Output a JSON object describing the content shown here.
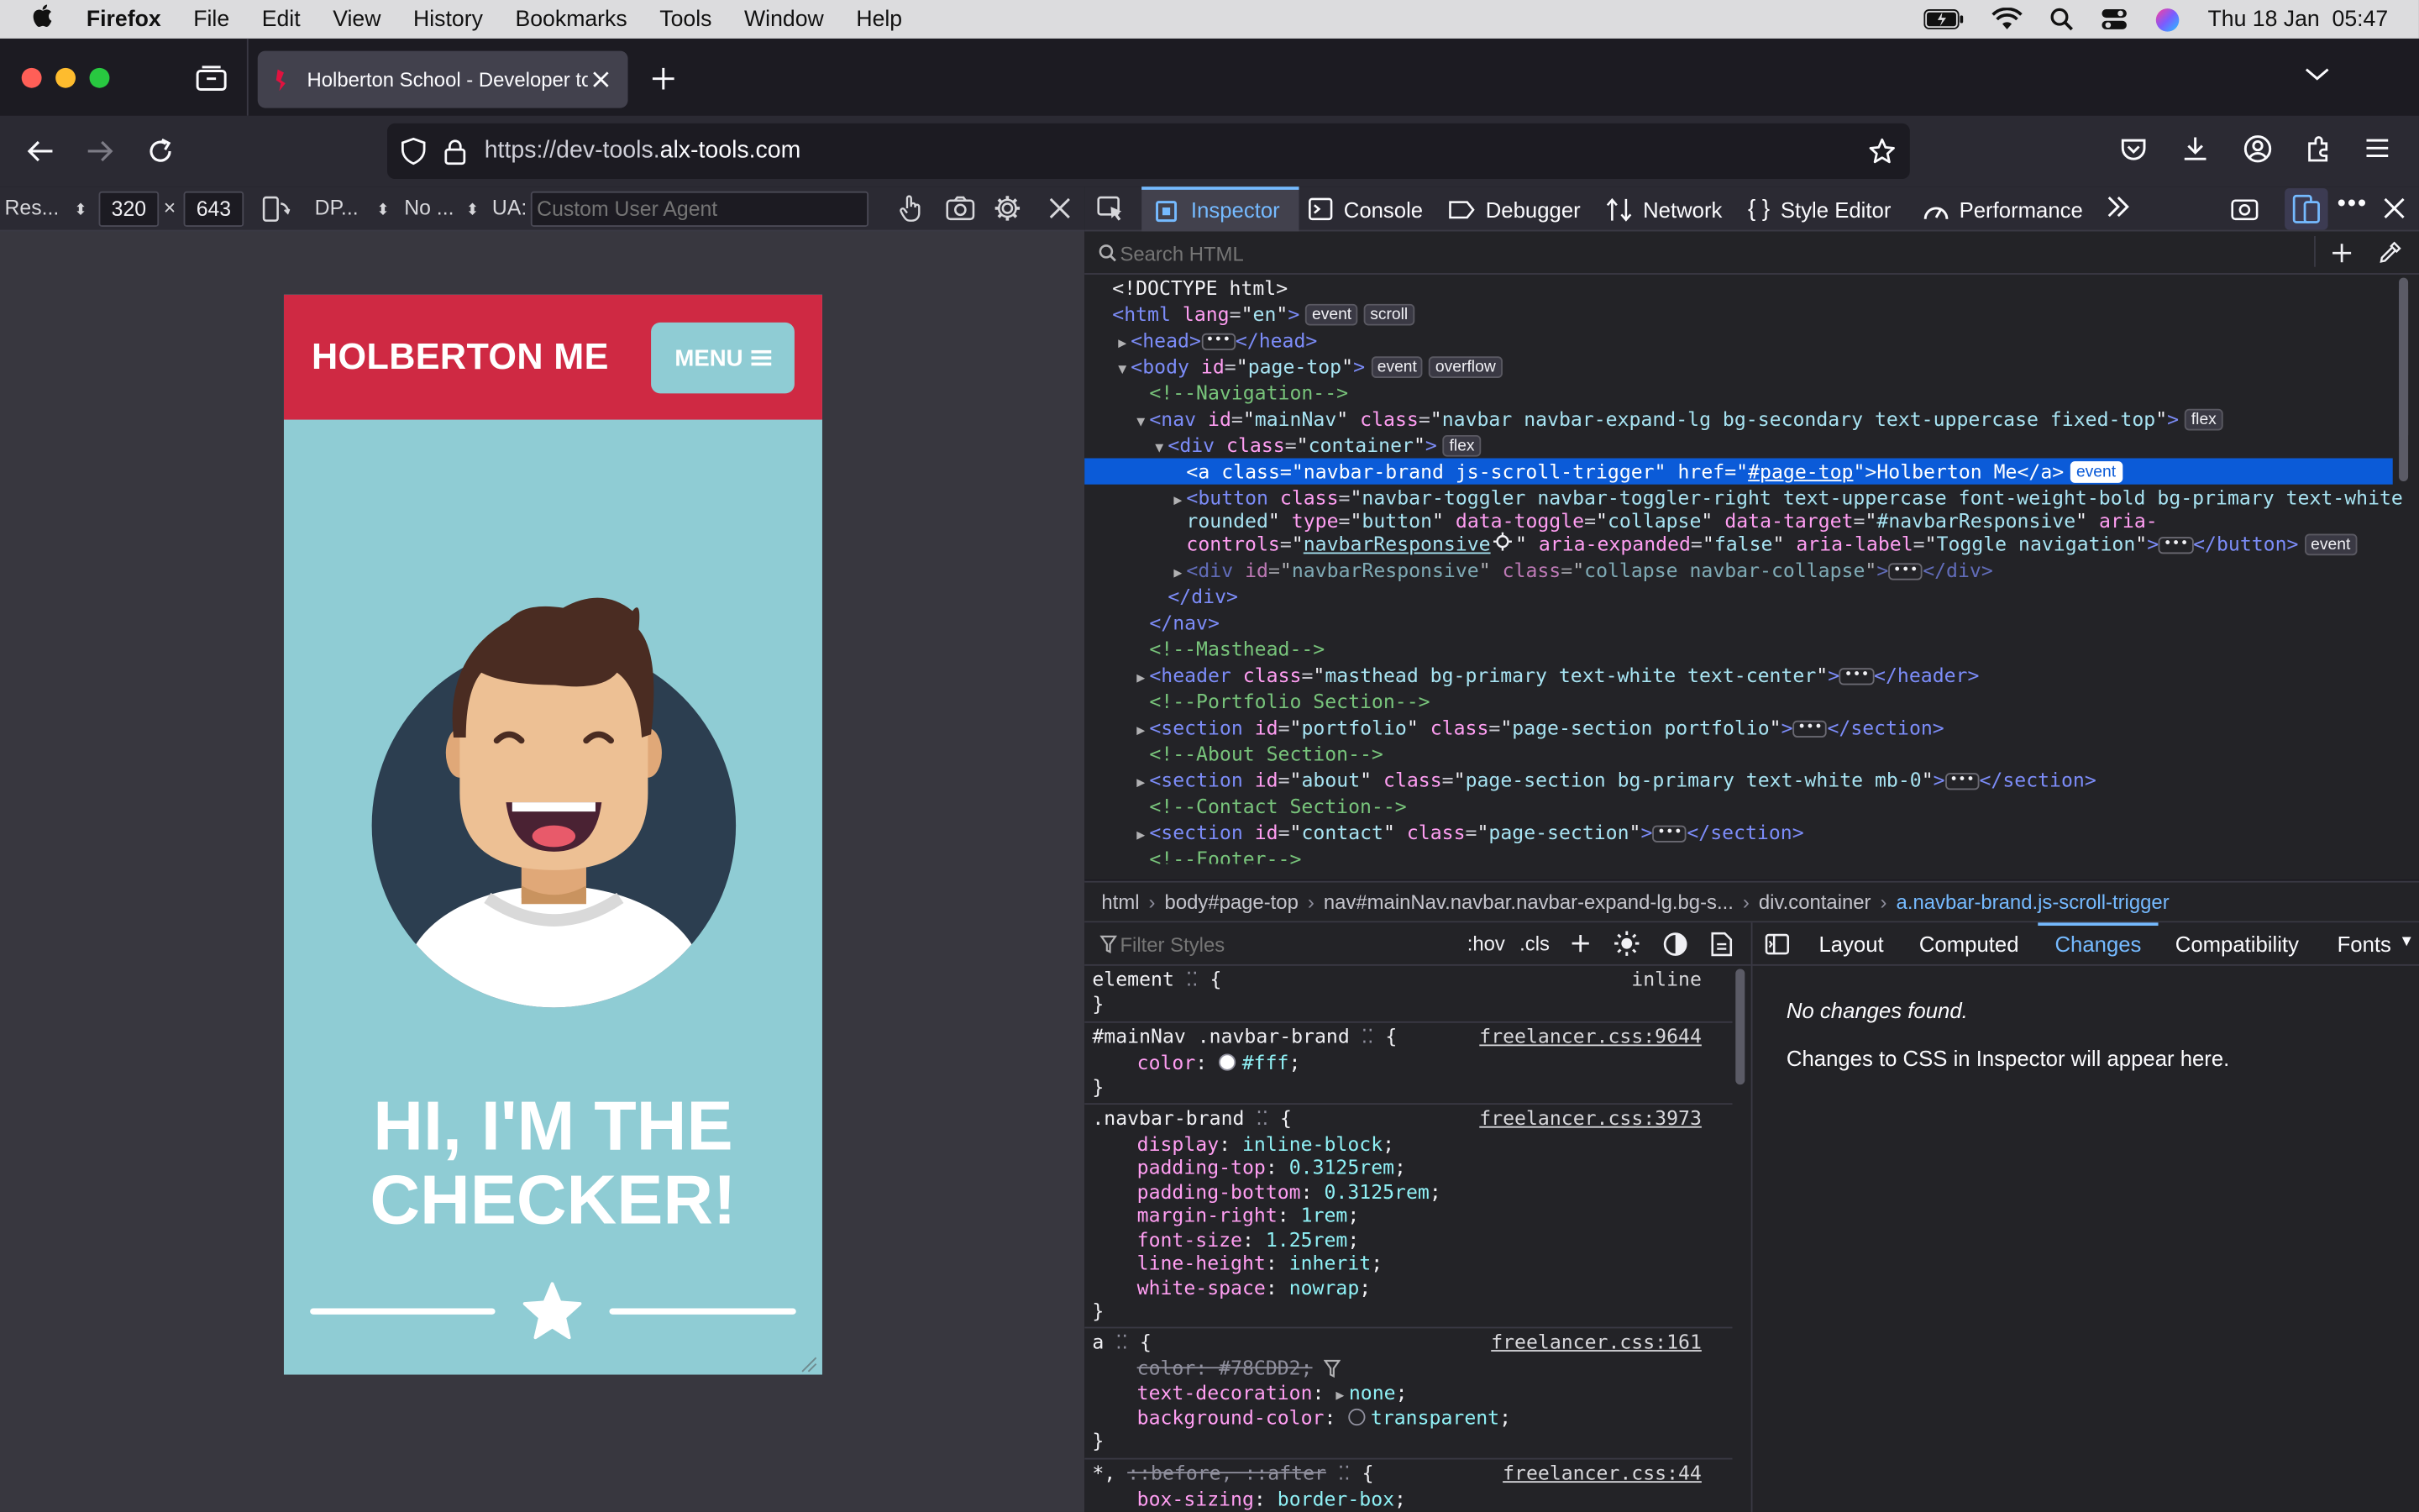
{
  "macos_menu": {
    "app_name": "Firefox",
    "items": [
      "File",
      "Edit",
      "View",
      "History",
      "Bookmarks",
      "Tools",
      "Window",
      "Help"
    ],
    "clock": "Thu 18 Jan  05:47"
  },
  "browser": {
    "tab_title": "Holberton School - Developer to",
    "url_prefix": "https://dev-tools.",
    "url_domain": "alx-tools.com"
  },
  "rdm": {
    "device_label": "Res...",
    "width": "320",
    "times": "×",
    "height": "643",
    "dpr_label": "DP...",
    "throttle_label": "No ...",
    "ua_label": "UA:",
    "ua_placeholder": "Custom User Agent"
  },
  "site": {
    "brand": "HOLBERTON ME",
    "menu_label": "MENU",
    "heading_line1": "HI, I'M THE",
    "heading_line2": "CHECKER!"
  },
  "devtools": {
    "tabs": [
      "Inspector",
      "Console",
      "Debugger",
      "Network",
      "Style Editor",
      "Performance"
    ],
    "search_placeholder": "Search HTML",
    "markup": {
      "doctype": "<!DOCTYPE html>",
      "html_tag": "html",
      "html_lang_attr": "lang",
      "html_lang_val": "en",
      "badge_event": "event",
      "badge_scroll": "scroll",
      "badge_overflow": "overflow",
      "badge_flex": "flex",
      "head_tag": "head",
      "body_tag": "body",
      "body_id_val": "page-top",
      "comment_navigation": "<!--Navigation-->",
      "nav_tag": "nav",
      "nav_id_val": "mainNav",
      "nav_class_val": "navbar navbar-expand-lg bg-secondary text-uppercase fixed-top",
      "div_tag": "div",
      "div_class_val": "container",
      "a_tag": "a",
      "a_class_val": "navbar-brand js-scroll-trigger",
      "a_href_val": "#page-top",
      "a_text": "Holberton Me",
      "button_tag": "button",
      "button_class_val": "navbar-toggler navbar-toggler-right text-uppercase font-weight-bold bg-primary text-white",
      "button_class_cont": "rounded",
      "button_type_val": "button",
      "button_toggle_val": "collapse",
      "button_target_val": "#navbarResponsive",
      "button_aria_controls_attr": "aria-",
      "button_aria_controls_attr2": "controls",
      "button_aria_controls_val": "navbarResponsive",
      "button_expanded_val": "false",
      "button_label_val": "Toggle navigation",
      "div2_id_val": "navbarResponsive",
      "div2_class_val": "collapse navbar-collapse",
      "comment_masthead": "<!--Masthead-->",
      "header_tag": "header",
      "header_class_val": "masthead bg-primary text-white text-center",
      "comment_portfolio": "<!--Portfolio Section-->",
      "section_tag": "section",
      "portfolio_id_val": "portfolio",
      "portfolio_class_val": "page-section portfolio",
      "comment_about": "<!--About Section-->",
      "about_id_val": "about",
      "about_class_val": "page-section bg-primary text-white mb-0",
      "comment_contact": "<!--Contact Section-->",
      "contact_id_val": "contact",
      "contact_class_val": "page-section",
      "comment_footer": "<!--Footer-->"
    },
    "breadcrumbs": [
      "html",
      "body#page-top",
      "nav#mainNav.navbar.navbar-expand-lg.bg-s...",
      "div.container",
      "a.navbar-brand.js-scroll-trigger"
    ],
    "filter_placeholder": "Filter Styles",
    "hov": ":hov",
    "cls": ".cls",
    "right_tabs": [
      "Layout",
      "Computed",
      "Changes",
      "Compatibility",
      "Fonts"
    ],
    "changes_title": "No changes found.",
    "changes_body": "Changes to CSS in Inspector will appear here.",
    "rules": {
      "element_selector": "element",
      "element_source": "inline",
      "r1_selector": "#mainNav .navbar-brand",
      "r1_source": "freelancer.css:9644",
      "r1_prop": "color",
      "r1_val": "#fff",
      "r2_selector": ".navbar-brand",
      "r2_source": "freelancer.css:3973",
      "r2_decls": [
        {
          "p": "display",
          "v": "inline-block"
        },
        {
          "p": "padding-top",
          "v": "0.3125rem"
        },
        {
          "p": "padding-bottom",
          "v": "0.3125rem"
        },
        {
          "p": "margin-right",
          "v": "1rem"
        },
        {
          "p": "font-size",
          "v": "1.25rem"
        },
        {
          "p": "line-height",
          "v": "inherit"
        },
        {
          "p": "white-space",
          "v": "nowrap"
        }
      ],
      "r3_selector": "a",
      "r3_source": "freelancer.css:161",
      "r3_color_strike": "color: #78CDD2;",
      "r3_td_prop": "text-decoration",
      "r3_td_val": "none",
      "r3_bg_prop": "background-color",
      "r3_bg_val": "transparent",
      "r4_selector_a": "*,",
      "r4_selector_b": "::before, ::after",
      "r4_source": "freelancer.css:44",
      "r4_prop": "box-sizing",
      "r4_val": "border-box"
    }
  },
  "colors": {
    "site_red": "#cf2943",
    "site_teal": "#8fccd4",
    "menu_button": "#8fccd4",
    "avatar_bg": "#2c3e50",
    "selected_row": "#0b5bd8",
    "devtools_accent": "#75baff"
  }
}
